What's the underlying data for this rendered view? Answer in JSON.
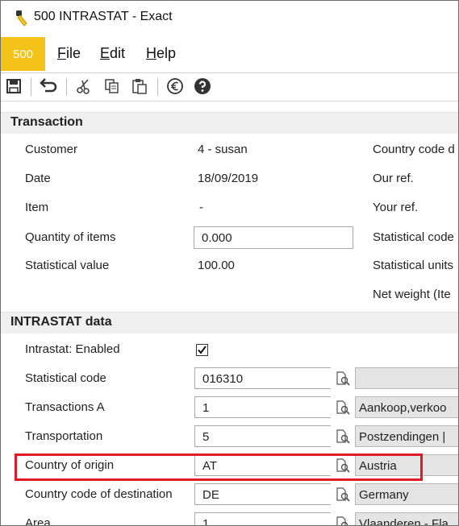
{
  "window": {
    "title": "500 INTRASTAT - Exact"
  },
  "menu": {
    "company": "500",
    "items": [
      {
        "accel": "F",
        "rest": "ile"
      },
      {
        "accel": "E",
        "rest": "dit"
      },
      {
        "accel": "H",
        "rest": "elp"
      }
    ]
  },
  "transaction": {
    "heading": "Transaction",
    "customer_label": "Customer",
    "customer_value": "4 - susan",
    "date_label": "Date",
    "date_value": "18/09/2019",
    "item_label": "Item",
    "item_value": "-",
    "quantity_label": "Quantity of items",
    "quantity_value": "0.000",
    "statval_label": "Statistical value",
    "statval_value": "100.00",
    "right_labels": {
      "country_code": "Country code d",
      "our_ref": "Our ref.",
      "your_ref": "Your ref.",
      "stat_code": "Statistical code",
      "stat_units": "Statistical units",
      "net_weight": "Net weight (Ite"
    }
  },
  "intrastat": {
    "heading": "INTRASTAT data",
    "enabled_label": "Intrastat: Enabled",
    "enabled_checked": true,
    "rows": {
      "stat_code": {
        "label": "Statistical code",
        "value": "016310",
        "desc": ""
      },
      "transactions": {
        "label": "Transactions A",
        "value": "1",
        "desc": "Aankoop,verkoo"
      },
      "transportation": {
        "label": "Transportation",
        "value": "5",
        "desc": "Postzendingen |"
      },
      "origin": {
        "label": "Country of origin",
        "value": "AT",
        "desc": "Austria"
      },
      "destination": {
        "label": "Country code of destination",
        "value": "DE",
        "desc": "Germany"
      },
      "area": {
        "label": "Area",
        "value": "1",
        "desc": "Vlaanderen - Fla"
      }
    }
  },
  "colors": {
    "highlight": "#e01b24",
    "brand": "#f3c31a"
  }
}
